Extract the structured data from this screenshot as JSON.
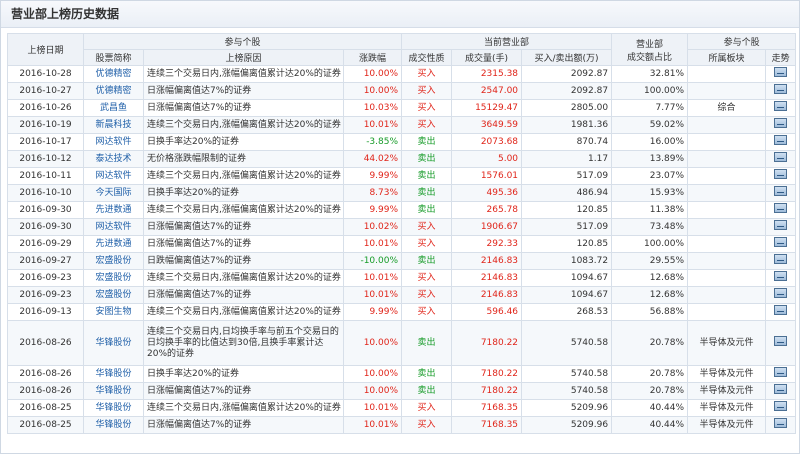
{
  "page": {
    "title": "营业部上榜历史数据"
  },
  "table": {
    "headers": {
      "date": "上榜日期",
      "group_stock": "参与个股",
      "group_dept": "当前营业部",
      "share": "营业部",
      "share2": "成交额占比",
      "group_stock2": "参与个股",
      "code_name": "股票简称",
      "reason": "上榜原因",
      "change": "涨跌幅",
      "direction": "成交性质",
      "volume": "成交量(手)",
      "amount": "买入/卖出额(万)",
      "sector": "所属板块",
      "trend": "走势"
    },
    "rows": [
      {
        "date": "2016-10-28",
        "name": "优德精密",
        "reason": "连续三个交易日内,涨幅偏离值累计达20%的证券",
        "change": "10.00%",
        "change_color": "red",
        "direction": "买入",
        "dir_color": "red",
        "volume": "2315.38",
        "amount": "2092.87",
        "ratio": "32.81%",
        "sector": ""
      },
      {
        "date": "2016-10-27",
        "name": "优德精密",
        "reason": "日涨幅偏离值达7%的证券",
        "change": "10.00%",
        "change_color": "red",
        "direction": "买入",
        "dir_color": "red",
        "volume": "2547.00",
        "amount": "2092.87",
        "ratio": "100.00%",
        "sector": ""
      },
      {
        "date": "2016-10-26",
        "name": "武昌鱼",
        "reason": "日涨幅偏离值达7%的证券",
        "change": "10.03%",
        "change_color": "red",
        "direction": "买入",
        "dir_color": "red",
        "volume": "15129.47",
        "amount": "2805.00",
        "ratio": "7.77%",
        "sector": "综合"
      },
      {
        "date": "2016-10-19",
        "name": "新晨科技",
        "reason": "连续三个交易日内,涨幅偏离值累计达20%的证券",
        "change": "10.01%",
        "change_color": "red",
        "direction": "买入",
        "dir_color": "red",
        "volume": "3649.59",
        "amount": "1981.36",
        "ratio": "59.02%",
        "sector": ""
      },
      {
        "date": "2016-10-17",
        "name": "网达软件",
        "reason": "日换手率达20%的证券",
        "change": "-3.85%",
        "change_color": "green",
        "direction": "卖出",
        "dir_color": "green",
        "volume": "2073.68",
        "amount": "870.74",
        "ratio": "16.00%",
        "sector": ""
      },
      {
        "date": "2016-10-12",
        "name": "泰达技术",
        "reason": "无价格涨跌幅限制的证券",
        "change": "44.02%",
        "change_color": "red",
        "direction": "卖出",
        "dir_color": "green",
        "volume": "5.00",
        "amount": "1.17",
        "ratio": "13.89%",
        "sector": ""
      },
      {
        "date": "2016-10-11",
        "name": "网达软件",
        "reason": "连续三个交易日内,涨幅偏离值累计达20%的证券",
        "change": "9.99%",
        "change_color": "red",
        "direction": "卖出",
        "dir_color": "green",
        "volume": "1576.01",
        "amount": "517.09",
        "ratio": "23.07%",
        "sector": ""
      },
      {
        "date": "2016-10-10",
        "name": "今天国际",
        "reason": "日换手率达20%的证券",
        "change": "8.73%",
        "change_color": "red",
        "direction": "卖出",
        "dir_color": "green",
        "volume": "495.36",
        "amount": "486.94",
        "ratio": "15.93%",
        "sector": ""
      },
      {
        "date": "2016-09-30",
        "name": "先进数通",
        "reason": "连续三个交易日内,涨幅偏离值累计达20%的证券",
        "change": "9.99%",
        "change_color": "red",
        "direction": "卖出",
        "dir_color": "green",
        "volume": "265.78",
        "amount": "120.85",
        "ratio": "11.38%",
        "sector": ""
      },
      {
        "date": "2016-09-30",
        "name": "网达软件",
        "reason": "日涨幅偏离值达7%的证券",
        "change": "10.02%",
        "change_color": "red",
        "direction": "买入",
        "dir_color": "red",
        "volume": "1906.67",
        "amount": "517.09",
        "ratio": "73.48%",
        "sector": ""
      },
      {
        "date": "2016-09-29",
        "name": "先进数通",
        "reason": "日涨幅偏离值达7%的证券",
        "change": "10.01%",
        "change_color": "red",
        "direction": "买入",
        "dir_color": "red",
        "volume": "292.33",
        "amount": "120.85",
        "ratio": "100.00%",
        "sector": ""
      },
      {
        "date": "2016-09-27",
        "name": "宏盛股份",
        "reason": "日跌幅偏离值达7%的证券",
        "change": "-10.00%",
        "change_color": "green",
        "direction": "卖出",
        "dir_color": "green",
        "volume": "2146.83",
        "amount": "1083.72",
        "ratio": "29.55%",
        "sector": ""
      },
      {
        "date": "2016-09-23",
        "name": "宏盛股份",
        "reason": "连续三个交易日内,涨幅偏离值累计达20%的证券",
        "change": "10.01%",
        "change_color": "red",
        "direction": "买入",
        "dir_color": "red",
        "volume": "2146.83",
        "amount": "1094.67",
        "ratio": "12.68%",
        "sector": ""
      },
      {
        "date": "2016-09-23",
        "name": "宏盛股份",
        "reason": "日涨幅偏离值达7%的证券",
        "change": "10.01%",
        "change_color": "red",
        "direction": "买入",
        "dir_color": "red",
        "volume": "2146.83",
        "amount": "1094.67",
        "ratio": "12.68%",
        "sector": ""
      },
      {
        "date": "2016-09-13",
        "name": "安图生物",
        "reason": "连续三个交易日内,涨幅偏离值累计达20%的证券",
        "change": "9.99%",
        "change_color": "red",
        "direction": "买入",
        "dir_color": "red",
        "volume": "596.46",
        "amount": "268.53",
        "ratio": "56.88%",
        "sector": ""
      },
      {
        "date": "2016-08-26",
        "name": "华锋股份",
        "reason": "连续三个交易日内,日均换手率与前五个交易日的日均换手率的比值达到30倍,且换手率累计达20%的证券",
        "change": "10.00%",
        "change_color": "red",
        "direction": "卖出",
        "dir_color": "green",
        "volume": "7180.22",
        "amount": "5740.58",
        "ratio": "20.78%",
        "sector": "半导体及元件",
        "tall": true
      },
      {
        "date": "2016-08-26",
        "name": "华锋股份",
        "reason": "日换手率达20%的证券",
        "change": "10.00%",
        "change_color": "red",
        "direction": "卖出",
        "dir_color": "green",
        "volume": "7180.22",
        "amount": "5740.58",
        "ratio": "20.78%",
        "sector": "半导体及元件"
      },
      {
        "date": "2016-08-26",
        "name": "华锋股份",
        "reason": "日涨幅偏离值达7%的证券",
        "change": "10.00%",
        "change_color": "red",
        "direction": "卖出",
        "dir_color": "green",
        "volume": "7180.22",
        "amount": "5740.58",
        "ratio": "20.78%",
        "sector": "半导体及元件"
      },
      {
        "date": "2016-08-25",
        "name": "华锋股份",
        "reason": "连续三个交易日内,涨幅偏离值累计达20%的证券",
        "change": "10.01%",
        "change_color": "red",
        "direction": "买入",
        "dir_color": "red",
        "volume": "7168.35",
        "amount": "5209.96",
        "ratio": "40.44%",
        "sector": "半导体及元件"
      },
      {
        "date": "2016-08-25",
        "name": "华锋股份",
        "reason": "日涨幅偏离值达7%的证券",
        "change": "10.01%",
        "change_color": "red",
        "direction": "买入",
        "dir_color": "red",
        "volume": "7168.35",
        "amount": "5209.96",
        "ratio": "40.44%",
        "sector": "半导体及元件"
      }
    ]
  },
  "icons": {
    "trend": "chart-icon"
  }
}
